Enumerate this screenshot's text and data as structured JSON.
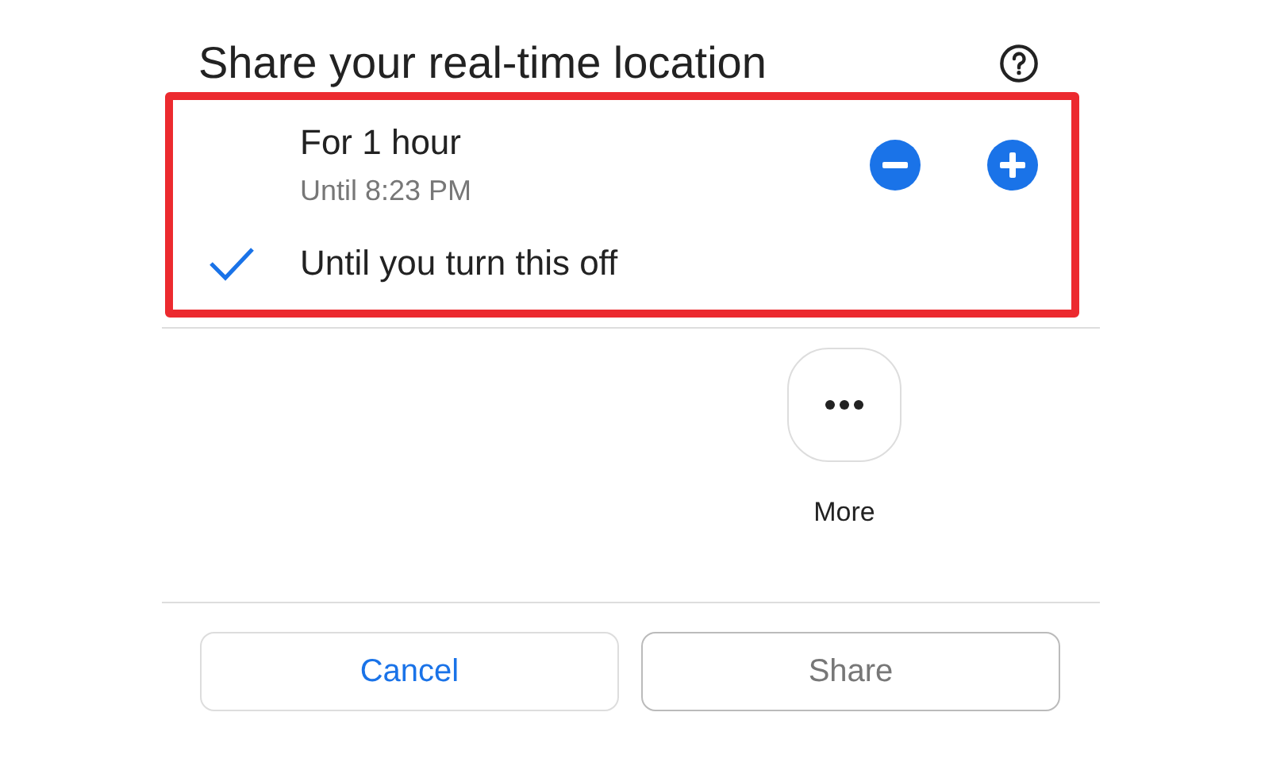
{
  "dialog": {
    "title": "Share your real-time location"
  },
  "options": [
    {
      "kind": "duration",
      "label": "For 1 hour",
      "sublabel": "Until 8:23 PM",
      "selected": false
    },
    {
      "kind": "indefinite",
      "label": "Until you turn this off",
      "selected": true
    }
  ],
  "share_targets": [
    {
      "label": "More"
    }
  ],
  "buttons": [
    {
      "kind": "cancel",
      "label": "Cancel",
      "disabled": false
    },
    {
      "kind": "share",
      "label": "Share",
      "disabled": true
    }
  ]
}
